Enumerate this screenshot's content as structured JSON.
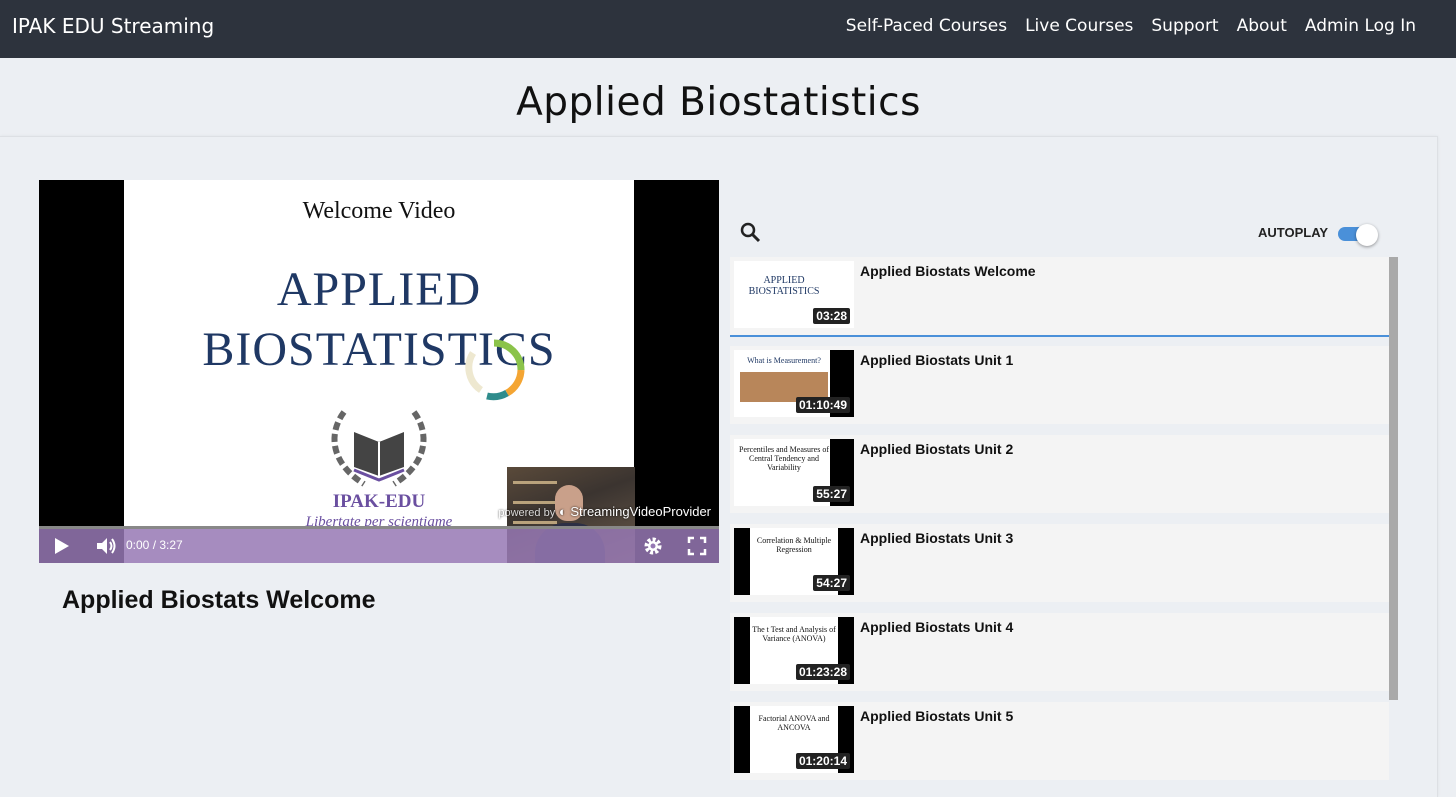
{
  "navbar": {
    "brand": "IPAK EDU Streaming",
    "links": [
      "Self-Paced Courses",
      "Live Courses",
      "Support",
      "About",
      "Admin Log In"
    ]
  },
  "page": {
    "title": "Applied Biostatistics",
    "current_video_title": "Applied Biostats Welcome"
  },
  "player": {
    "slide": {
      "heading": "Welcome Video",
      "title_line1": "APPLIED",
      "title_line2": "BIOSTATISTICS",
      "org": "IPAK-EDU",
      "motto": "Libertate per scientiame"
    },
    "powered_prefix": "powered by",
    "powered_brand": "StreamingVideoProvider",
    "time": "0:00 / 3:27",
    "progress": 0
  },
  "sidebar": {
    "autoplay_label": "AUTOPLAY",
    "autoplay_on": true
  },
  "playlist": [
    {
      "title": "Applied Biostats Welcome",
      "duration": "03:28",
      "thumb": "APPLIED BIOSTATISTICS",
      "active": true
    },
    {
      "title": "Applied Biostats Unit 1",
      "duration": "01:10:49",
      "thumb": "What is Measurement?",
      "active": false
    },
    {
      "title": "Applied Biostats Unit 2",
      "duration": "55:27",
      "thumb": "Percentiles and Measures of Central Tendency and Variability",
      "active": false
    },
    {
      "title": "Applied Biostats Unit 3",
      "duration": "54:27",
      "thumb": "Correlation & Multiple Regression",
      "active": false
    },
    {
      "title": "Applied Biostats Unit 4",
      "duration": "01:23:28",
      "thumb": "The t Test and Analysis of Variance (ANOVA)",
      "active": false
    },
    {
      "title": "Applied Biostats Unit 5",
      "duration": "01:20:14",
      "thumb": "Factorial ANOVA and ANCOVA",
      "active": false
    }
  ],
  "colors": {
    "navbar_bg": "#2d333d",
    "accent": "#4a90d9",
    "slide_title": "#1f3864",
    "org_purple": "#6a4fa0"
  }
}
